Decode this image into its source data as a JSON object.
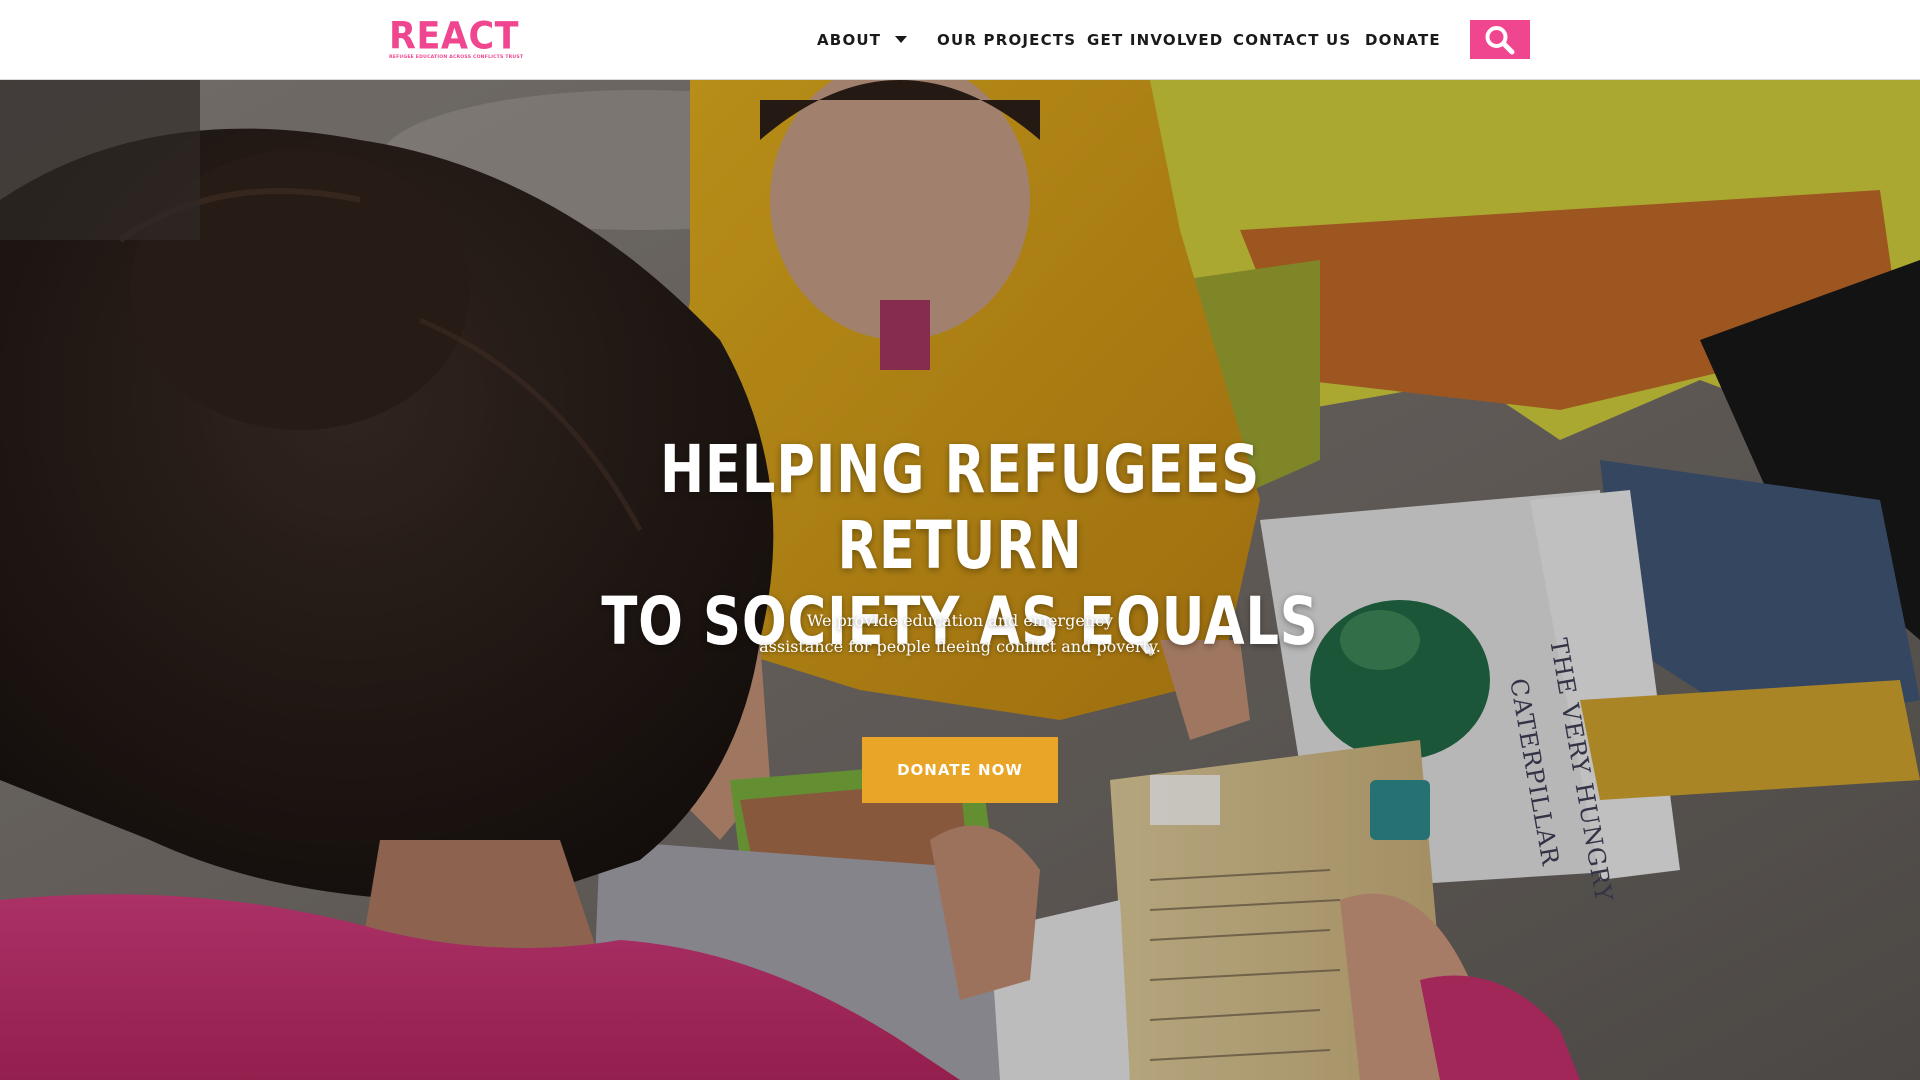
{
  "logo": {
    "wordmark": "REACT",
    "tagline": "REFUGEE EDUCATION ACROSS CONFLICTS TRUST",
    "color": "#f0468f"
  },
  "nav": {
    "items": [
      {
        "label": "ABOUT",
        "has_dropdown": true
      },
      {
        "label": "OUR PROJECTS"
      },
      {
        "label": "GET INVOLVED"
      },
      {
        "label": "CONTACT US"
      },
      {
        "label": "DONATE"
      }
    ],
    "search_icon": "search-icon",
    "search_color": "#f0468f"
  },
  "hero": {
    "title_line1": "HELPING REFUGEES RETURN",
    "title_line2": "TO SOCIETY AS EQUALS",
    "subtitle_line1": "We provide education and emergency",
    "subtitle_line2": "assistance for people fleeing conflict and poverty.",
    "cta_label": "DONATE NOW",
    "cta_color": "#e8a527",
    "book_spine_text": "THE VERY HUNGRY CATERPILLAR"
  }
}
